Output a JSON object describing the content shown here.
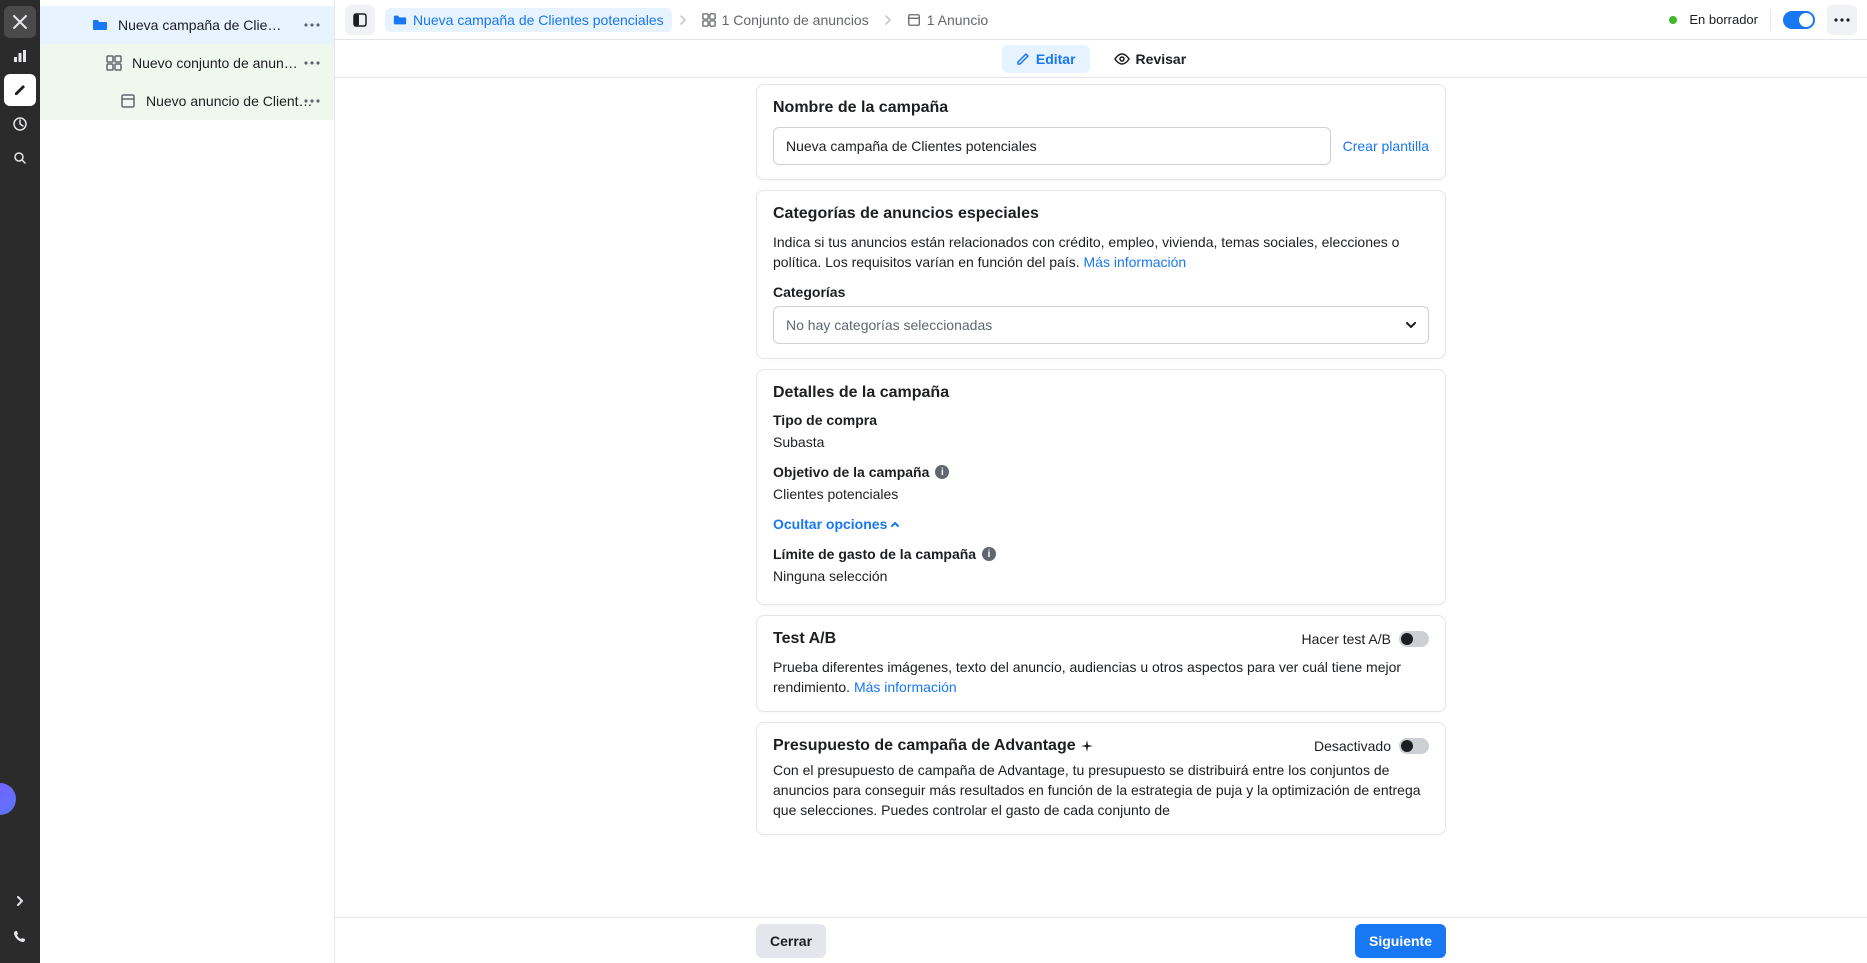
{
  "rail": {
    "items": [
      "close",
      "chart",
      "edit",
      "clock",
      "search"
    ],
    "bottom_item": "phone"
  },
  "sidebar": {
    "campaign": "Nueva campaña de Clientes potenciales",
    "adset": "Nuevo conjunto de anuncios de Client...",
    "ad": "Nuevo anuncio de Clientes potencia..."
  },
  "breadcrumbs": {
    "campaign": "Nueva campaña de Clientes potenciales",
    "adset": "1 Conjunto de anuncios",
    "ad": "1 Anuncio"
  },
  "topright": {
    "status": "En borrador"
  },
  "tabs": {
    "edit": "Editar",
    "review": "Revisar"
  },
  "campaign_name": {
    "title": "Nombre de la campaña",
    "value": "Nueva campaña de Clientes potenciales",
    "create_template": "Crear plantilla"
  },
  "special_categories": {
    "title": "Categorías de anuncios especiales",
    "desc": "Indica si tus anuncios están relacionados con crédito, empleo, vivienda, temas sociales, elecciones o política. Los requisitos varían en función del país. ",
    "more_info": "Más información",
    "categories_label": "Categorías",
    "categories_placeholder": "No hay categorías seleccionadas"
  },
  "details": {
    "title": "Detalles de la campaña",
    "buying_label": "Tipo de compra",
    "buying_value": "Subasta",
    "objective_label": "Objetivo de la campaña",
    "objective_value": "Clientes potenciales",
    "hide_options": "Ocultar opciones",
    "spend_limit_label": "Límite de gasto de la campaña",
    "spend_limit_value": "Ninguna selección"
  },
  "abtest": {
    "title": "Test A/B",
    "switch_label": "Hacer test A/B",
    "desc": "Prueba diferentes imágenes, texto del anuncio, audiencias u otros aspectos para ver cuál tiene mejor rendimiento. ",
    "more_info": "Más información"
  },
  "advantage": {
    "title": "Presupuesto de campaña de Advantage",
    "switch_label": "Desactivado",
    "desc": "Con el presupuesto de campaña de Advantage, tu presupuesto se distribuirá entre los conjuntos de anuncios para conseguir más resultados en función de la estrategia de puja y la optimización de entrega que selecciones. Puedes controlar el gasto de cada conjunto de"
  },
  "footer": {
    "close": "Cerrar",
    "next": "Siguiente"
  }
}
